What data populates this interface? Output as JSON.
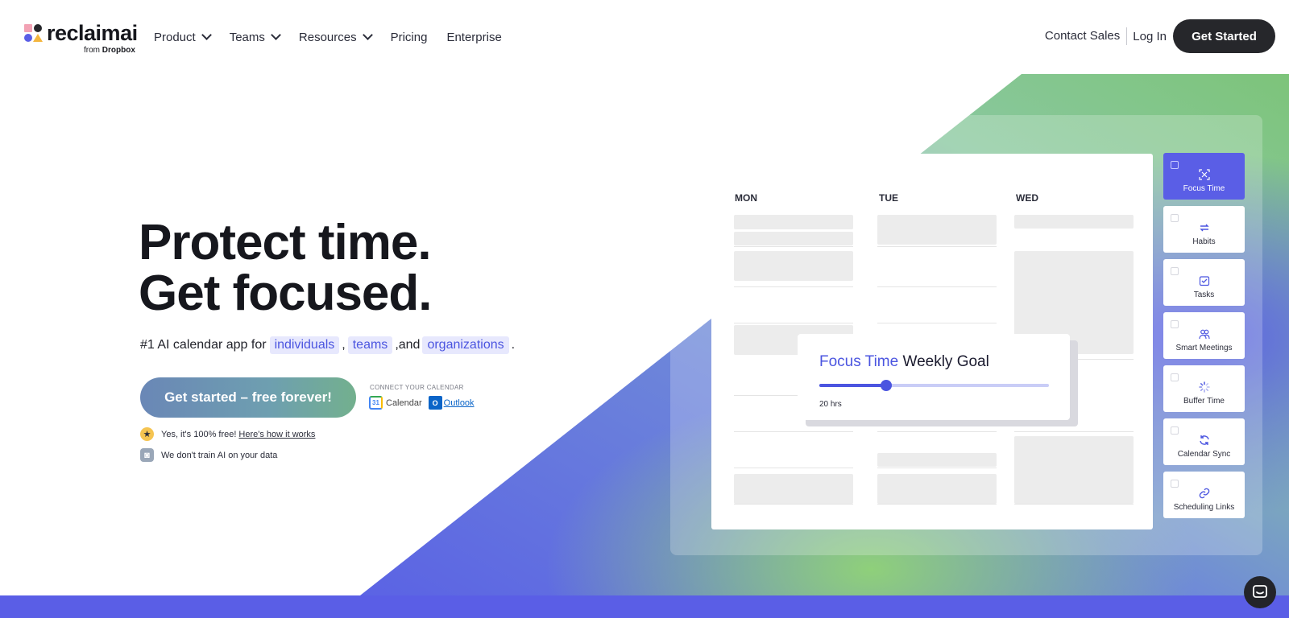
{
  "nav": {
    "logo_word": "reclaimai",
    "logo_sub_prefix": "from",
    "logo_sub_brand": "Dropbox",
    "links": [
      {
        "label": "Product",
        "dropdown": true
      },
      {
        "label": "Teams",
        "dropdown": true
      },
      {
        "label": "Resources",
        "dropdown": true
      },
      {
        "label": "Pricing",
        "dropdown": false
      },
      {
        "label": "Enterprise",
        "dropdown": false
      }
    ],
    "contact_sales": "Contact Sales",
    "login": "Log In",
    "get_started": "Get Started"
  },
  "hero": {
    "headline_line1": "Protect time.",
    "headline_line2": "Get focused.",
    "subline_prefix": "#1 AI calendar app for",
    "chip_individuals": "individuals",
    "sep_comma": ",",
    "chip_teams": "teams",
    "sep_and": ",and",
    "chip_organizations": "organizations",
    "sep_period": ".",
    "cta": "Get started – free forever!",
    "connect_label": "CONNECT YOUR CALENDAR",
    "google_calendar": "Calendar",
    "google_calendar_badge": "31",
    "outlook": "Outlook",
    "outlook_badge": "O",
    "note_free": "Yes, it's 100% free!",
    "note_free_link": "Here's how it works",
    "note_ai": "We don't train AI on your data"
  },
  "mockup": {
    "days": [
      "MON",
      "TUE",
      "WED"
    ],
    "goal_accent": "Focus Time",
    "goal_rest": "Weekly Goal",
    "goal_label": "20 hrs",
    "goal_progress": 0.29,
    "side_items": [
      {
        "label": "Focus Time",
        "icon": "focus-icon",
        "active": true
      },
      {
        "label": "Habits",
        "icon": "repeat-icon",
        "active": false
      },
      {
        "label": "Tasks",
        "icon": "task-check-icon",
        "active": false
      },
      {
        "label": "Smart Meetings",
        "icon": "people-icon",
        "active": false
      },
      {
        "label": "Buffer Time",
        "icon": "spinner-icon",
        "active": false
      },
      {
        "label": "Calendar Sync",
        "icon": "sync-icon",
        "active": false
      },
      {
        "label": "Scheduling Links",
        "icon": "link-icon",
        "active": false
      }
    ]
  },
  "colors": {
    "accent": "#4b55e0",
    "band": "#5a5ee6",
    "green": "#7fc47e",
    "dark_button": "#26272b"
  }
}
